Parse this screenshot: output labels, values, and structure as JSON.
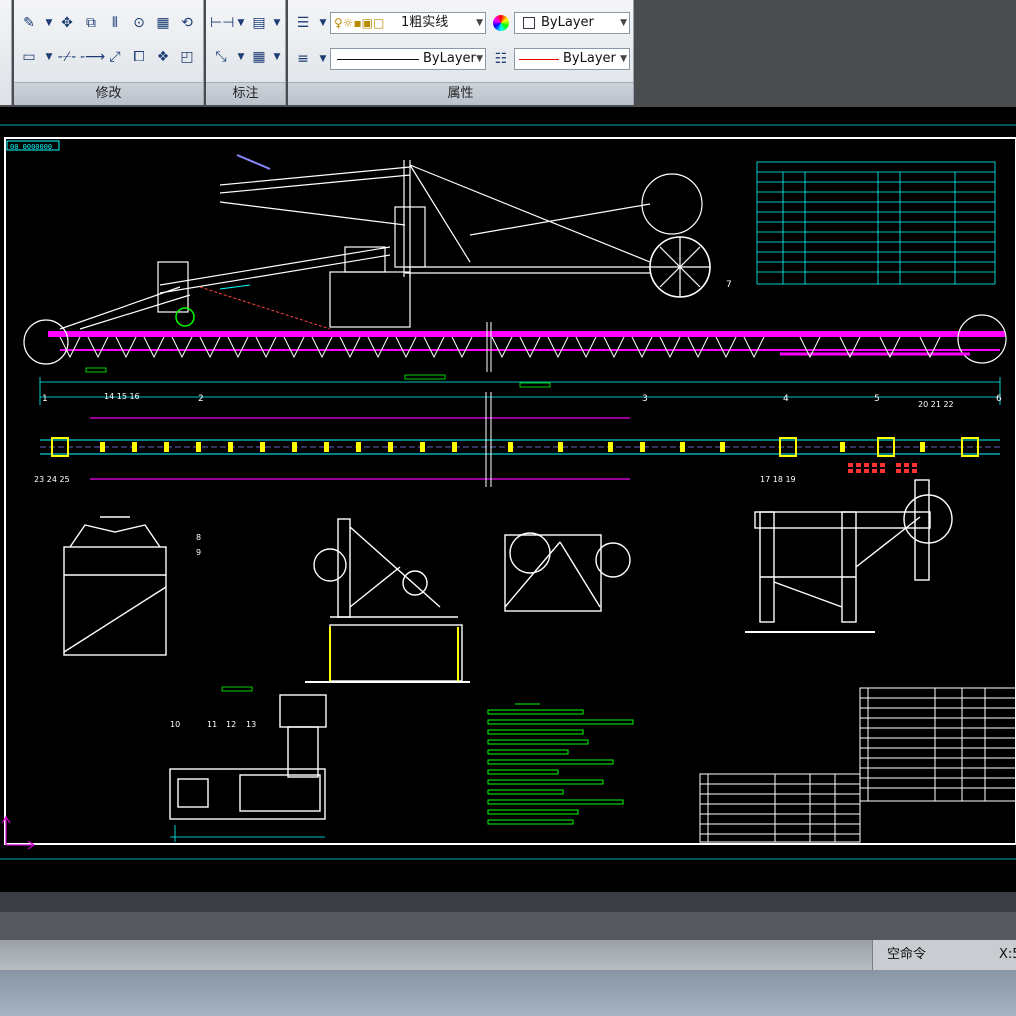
{
  "ribbon": {
    "panels": {
      "modify": "修改",
      "annotation": "标注",
      "properties": "属性"
    },
    "properties": {
      "layer_value": "1粗实线",
      "color_value": "ByLayer",
      "lineweight_value": "ByLayer",
      "linetype_value": "ByLayer"
    }
  },
  "drawing": {
    "title_block_tag": "00 0000000",
    "labels": {
      "l1": "1",
      "l2": "2",
      "l3": "3",
      "l4": "4",
      "l5": "5",
      "l6": "6",
      "l7": "7",
      "l8a": "8",
      "l8b": "9",
      "l10": "10",
      "l11": "11",
      "l12": "12",
      "l13": "13",
      "g14": "14 15 16",
      "g17": "17 18 19",
      "g20": "20 21 22",
      "g23": "23 24 25"
    },
    "colors": {
      "accent_magenta": "#ff00ff",
      "accent_cyan": "#00ffff",
      "accent_yellow": "#ffff00",
      "accent_green": "#00ff00",
      "frame": "#ffffff"
    }
  },
  "status": {
    "command_prompt": "空命令",
    "coord_prefix": "X:5"
  }
}
